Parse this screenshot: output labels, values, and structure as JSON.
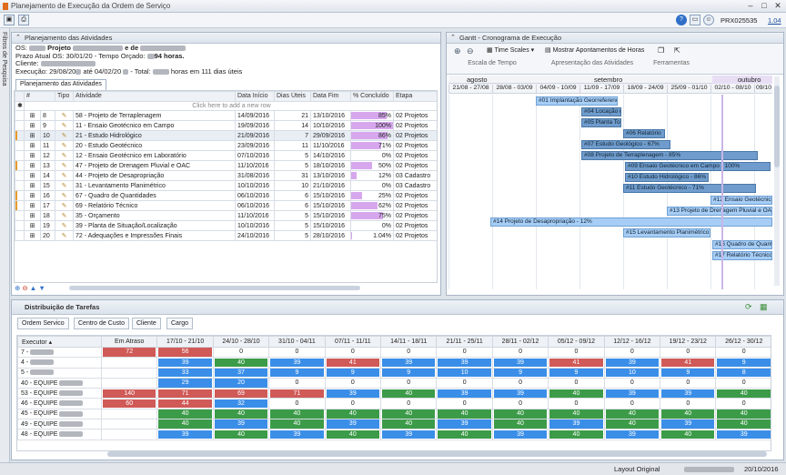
{
  "window": {
    "title": "Planejamento de Execução da Ordem de Serviço",
    "user": "PRX025535",
    "version": "1.04"
  },
  "side_tab": "Filtros de Pesquisa",
  "activities_panel": {
    "title": "Planejamento das Atividades",
    "os_label": "OS:",
    "project": "Projeto",
    "project_sep": "e de",
    "deadline": "Prazo Atual OS: 30/01/20",
    "budget": "- Tempo Orçado:",
    "budget_hours": "94 horas.",
    "client": "Cliente:",
    "execution": "Execução: 29/08/20",
    "exec_until": "até 04/02/20",
    "exec_total": "- Total:",
    "exec_hours": "horas em 111 dias úteis",
    "tab": "Planejamento das Atividades",
    "add_row": "Click here to add a new row",
    "columns": [
      "#",
      "Tipo",
      "Atividade",
      "Data Início",
      "Dias Úteis",
      "Data Fim",
      "% Concluído",
      "Etapa"
    ],
    "rows": [
      {
        "n": "8",
        "act": "58 - Projeto de Terraplenagem",
        "start": "14/09/2016",
        "days": "21",
        "end": "13/10/2016",
        "pct": "85%",
        "p": 85,
        "stage": "02 Projetos",
        "flag": false
      },
      {
        "n": "9",
        "act": "11 - Ensaio Geotécnico em Campo",
        "start": "19/09/2016",
        "days": "14",
        "end": "10/10/2016",
        "pct": "100%",
        "p": 100,
        "stage": "02 Projetos",
        "flag": false
      },
      {
        "n": "10",
        "act": "21 - Estudo Hidrológico",
        "start": "21/09/2016",
        "days": "7",
        "end": "29/09/2016",
        "pct": "86%",
        "p": 86,
        "stage": "02 Projetos",
        "flag": true
      },
      {
        "n": "11",
        "act": "20 - Estudo Geotécnico",
        "start": "23/09/2016",
        "days": "11",
        "end": "11/10/2016",
        "pct": "71%",
        "p": 71,
        "stage": "02 Projetos",
        "flag": false
      },
      {
        "n": "12",
        "act": "12 - Ensaio Geotécnico em Laboratório",
        "start": "07/10/2016",
        "days": "5",
        "end": "14/10/2016",
        "pct": "0%",
        "p": 0,
        "stage": "02 Projetos",
        "flag": false
      },
      {
        "n": "13",
        "act": "47 - Projeto de Drenagem Pluvial e OAC",
        "start": "11/10/2016",
        "days": "5",
        "end": "18/10/2016",
        "pct": "50%",
        "p": 50,
        "stage": "02 Projetos",
        "flag": true
      },
      {
        "n": "14",
        "act": "44 - Projeto de Desapropriação",
        "start": "31/08/2016",
        "days": "31",
        "end": "13/10/2016",
        "pct": "12%",
        "p": 12,
        "stage": "03 Cadastro",
        "flag": false
      },
      {
        "n": "15",
        "act": "31 - Levantamento Planimétrico",
        "start": "10/10/2016",
        "days": "10",
        "end": "21/10/2016",
        "pct": "0%",
        "p": 0,
        "stage": "03 Cadastro",
        "flag": false
      },
      {
        "n": "16",
        "act": "67 - Quadro de Quantidades",
        "start": "06/10/2016",
        "days": "6",
        "end": "15/10/2016",
        "pct": "25%",
        "p": 25,
        "stage": "02 Projetos",
        "flag": true
      },
      {
        "n": "17",
        "act": "69 - Relatório Técnico",
        "start": "06/10/2016",
        "days": "6",
        "end": "15/10/2016",
        "pct": "62%",
        "p": 62,
        "stage": "02 Projetos",
        "flag": true
      },
      {
        "n": "18",
        "act": "35 - Orçamento",
        "start": "11/10/2016",
        "days": "5",
        "end": "15/10/2016",
        "pct": "75%",
        "p": 75,
        "stage": "02 Projetos",
        "flag": false
      },
      {
        "n": "19",
        "act": "39 - Planta de Situação/Localização",
        "start": "10/10/2016",
        "days": "5",
        "end": "15/10/2016",
        "pct": "0%",
        "p": 0,
        "stage": "02 Projetos",
        "flag": false
      },
      {
        "n": "20",
        "act": "72 - Adequações e Impressões Finais",
        "start": "24/10/2016",
        "days": "5",
        "end": "28/10/2016",
        "pct": "1.04%",
        "p": 1,
        "stage": "02 Projetos",
        "flag": false
      }
    ]
  },
  "gantt": {
    "title": "Gantt - Cronograma de Execução",
    "ribbon": {
      "time_scales": "Time Scales",
      "show_notes": "Mostrar Apontamentos de Horas",
      "g1": "Escala de Tempo",
      "g2": "Apresentação das Atividades",
      "g3": "Ferramentas"
    },
    "months": [
      "agosto",
      "setembro",
      "outubro"
    ],
    "weeks": [
      "21/08 - 27/08",
      "28/08 - 03/09",
      "04/09 - 10/09",
      "11/09 - 17/09",
      "18/09 - 24/09",
      "25/09 - 01/10",
      "02/10 - 08/10",
      "09/10"
    ],
    "bars": [
      "#01 Implantação Georreferenc",
      "#04 Locação d",
      "#05 Planta Top",
      "#06 Relatório",
      "#07 Estudo Geológico - 67%",
      "#08 Projeto de Terraplenagem - 85%",
      "#09 Ensaio Geotécnico em Campo - 100%",
      "#10 Estudo Hidrológico - 86%",
      "#11 Estudo Geotécnico - 71%",
      "#12 Ensaio Geotécnico",
      "#13 Projeto de Drenagem Pluvial e OAC",
      "#14 Projeto de Desapropriação - 12%",
      "#15 Levantamento Planimétrico",
      "#16 Quadro de Quant",
      "#17 Relatório Técnico"
    ]
  },
  "distribution": {
    "title": "Distribuição de Tarefas",
    "filters": [
      "Ordem Servico",
      "Centro de Custo",
      "Cliente",
      "Cargo"
    ],
    "exec_header": "Executor",
    "periods": [
      "Em Atraso",
      "17/10 - 21/10",
      "24/10 - 28/10",
      "31/10 - 04/11",
      "07/11 - 11/11",
      "14/11 - 18/11",
      "21/11 - 25/11",
      "28/11 - 02/12",
      "05/12 - 09/12",
      "12/12 - 16/12",
      "19/12 - 23/12",
      "26/12 - 30/12"
    ],
    "rows": [
      {
        "name": "7 -",
        "cells": [
          [
            "72",
            "r"
          ],
          [
            "56",
            "r"
          ],
          [
            "0",
            ""
          ],
          [
            "0",
            ""
          ],
          [
            "0",
            ""
          ],
          [
            "0",
            ""
          ],
          [
            "0",
            ""
          ],
          [
            "0",
            ""
          ],
          [
            "0",
            ""
          ],
          [
            "0",
            ""
          ],
          [
            "0",
            ""
          ],
          [
            "0",
            ""
          ]
        ]
      },
      {
        "name": "4 -",
        "cells": [
          [
            "",
            ""
          ],
          [
            "39",
            "b"
          ],
          [
            "40",
            "g"
          ],
          [
            "39",
            "b"
          ],
          [
            "41",
            "r"
          ],
          [
            "39",
            "b"
          ],
          [
            "39",
            "b"
          ],
          [
            "39",
            "b"
          ],
          [
            "41",
            "r"
          ],
          [
            "39",
            "b"
          ],
          [
            "41",
            "r"
          ],
          [
            "9",
            "b"
          ]
        ]
      },
      {
        "name": "5 -",
        "cells": [
          [
            "",
            ""
          ],
          [
            "33",
            "b"
          ],
          [
            "37",
            "b"
          ],
          [
            "9",
            "b"
          ],
          [
            "9",
            "b"
          ],
          [
            "9",
            "b"
          ],
          [
            "10",
            "b"
          ],
          [
            "9",
            "b"
          ],
          [
            "9",
            "b"
          ],
          [
            "10",
            "b"
          ],
          [
            "9",
            "b"
          ],
          [
            "8",
            "b"
          ]
        ]
      },
      {
        "name": "40 - EQUIPE",
        "cells": [
          [
            "",
            ""
          ],
          [
            "29",
            "b"
          ],
          [
            "20",
            "b"
          ],
          [
            "0",
            ""
          ],
          [
            "0",
            ""
          ],
          [
            "0",
            ""
          ],
          [
            "0",
            ""
          ],
          [
            "0",
            ""
          ],
          [
            "0",
            ""
          ],
          [
            "0",
            ""
          ],
          [
            "0",
            ""
          ],
          [
            "0",
            ""
          ]
        ]
      },
      {
        "name": "53 - EQUIPE",
        "cells": [
          [
            "140",
            "r"
          ],
          [
            "71",
            "r"
          ],
          [
            "69",
            "r"
          ],
          [
            "71",
            "r"
          ],
          [
            "39",
            "b"
          ],
          [
            "40",
            "g"
          ],
          [
            "39",
            "b"
          ],
          [
            "39",
            "b"
          ],
          [
            "40",
            "g"
          ],
          [
            "39",
            "b"
          ],
          [
            "39",
            "b"
          ],
          [
            "40",
            "g"
          ]
        ]
      },
      {
        "name": "46 - EQUIPE",
        "cells": [
          [
            "60",
            "r"
          ],
          [
            "44",
            "r"
          ],
          [
            "32",
            "b"
          ],
          [
            "0",
            ""
          ],
          [
            "0",
            ""
          ],
          [
            "0",
            ""
          ],
          [
            "0",
            ""
          ],
          [
            "0",
            ""
          ],
          [
            "0",
            ""
          ],
          [
            "0",
            ""
          ],
          [
            "0",
            ""
          ],
          [
            "0",
            ""
          ]
        ]
      },
      {
        "name": "45 - EQUIPE",
        "cells": [
          [
            "",
            ""
          ],
          [
            "40",
            "g"
          ],
          [
            "40",
            "g"
          ],
          [
            "40",
            "g"
          ],
          [
            "40",
            "g"
          ],
          [
            "40",
            "g"
          ],
          [
            "40",
            "g"
          ],
          [
            "40",
            "g"
          ],
          [
            "40",
            "g"
          ],
          [
            "40",
            "g"
          ],
          [
            "40",
            "g"
          ],
          [
            "40",
            "g"
          ]
        ]
      },
      {
        "name": "49 - EQUIPE",
        "cells": [
          [
            "",
            ""
          ],
          [
            "40",
            "g"
          ],
          [
            "39",
            "b"
          ],
          [
            "40",
            "g"
          ],
          [
            "39",
            "b"
          ],
          [
            "40",
            "g"
          ],
          [
            "39",
            "b"
          ],
          [
            "40",
            "g"
          ],
          [
            "39",
            "b"
          ],
          [
            "40",
            "g"
          ],
          [
            "39",
            "b"
          ],
          [
            "40",
            "g"
          ]
        ]
      },
      {
        "name": "48 - EQUIPE",
        "cells": [
          [
            "",
            ""
          ],
          [
            "39",
            "b"
          ],
          [
            "40",
            "g"
          ],
          [
            "39",
            "b"
          ],
          [
            "40",
            "g"
          ],
          [
            "39",
            "b"
          ],
          [
            "40",
            "g"
          ],
          [
            "39",
            "b"
          ],
          [
            "40",
            "g"
          ],
          [
            "39",
            "b"
          ],
          [
            "40",
            "g"
          ],
          [
            "39",
            "b"
          ]
        ]
      }
    ]
  },
  "status": {
    "layout": "Layout Original",
    "date": "20/10/2016"
  }
}
